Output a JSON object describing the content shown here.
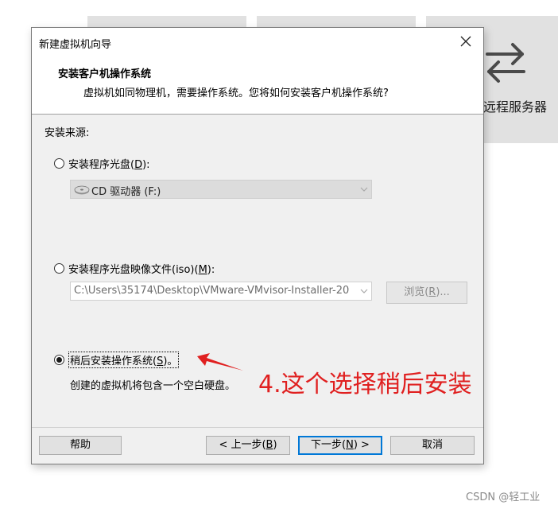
{
  "background": {
    "tile_label": "远程服务器",
    "tile_icon": "swap-arrows-icon"
  },
  "dialog": {
    "title": "新建虚拟机向导",
    "close_icon": "close-icon",
    "header": {
      "title": "安装客户机操作系统",
      "subtitle": "虚拟机如同物理机，需要操作系统。您将如何安装客户机操作系统?"
    },
    "source_label": "安装来源:",
    "options": {
      "cd": {
        "label": "安装程序光盘(",
        "mnemonic": "D",
        "suffix": "):",
        "selected": false
      },
      "iso": {
        "label": "安装程序光盘映像文件(iso)(",
        "mnemonic": "M",
        "suffix": "):",
        "selected": false
      },
      "later": {
        "label": "稍后安装操作系统(",
        "mnemonic": "S",
        "suffix": ")。",
        "selected": true,
        "description": "创建的虚拟机将包含一个空白硬盘。"
      }
    },
    "cd_drive_combo": {
      "value": "CD 驱动器 (F:)",
      "icon": "disk-drive-icon"
    },
    "iso_path_combo": {
      "value": "C:\\Users\\35174\\Desktop\\VMware-VMvisor-Installer-20"
    },
    "browse_button": {
      "label": "浏览(",
      "mnemonic": "R",
      "suffix": ")..."
    },
    "footer": {
      "help": "帮助",
      "back": {
        "prefix": "< 上一步(",
        "mnemonic": "B",
        "suffix": ")"
      },
      "next": {
        "prefix": "下一步(",
        "mnemonic": "N",
        "suffix": ") >"
      },
      "cancel": "取消"
    }
  },
  "annotation": {
    "text": "4.这个选择稍后安装",
    "color": "#e02020"
  },
  "watermark": "CSDN @轻工业"
}
